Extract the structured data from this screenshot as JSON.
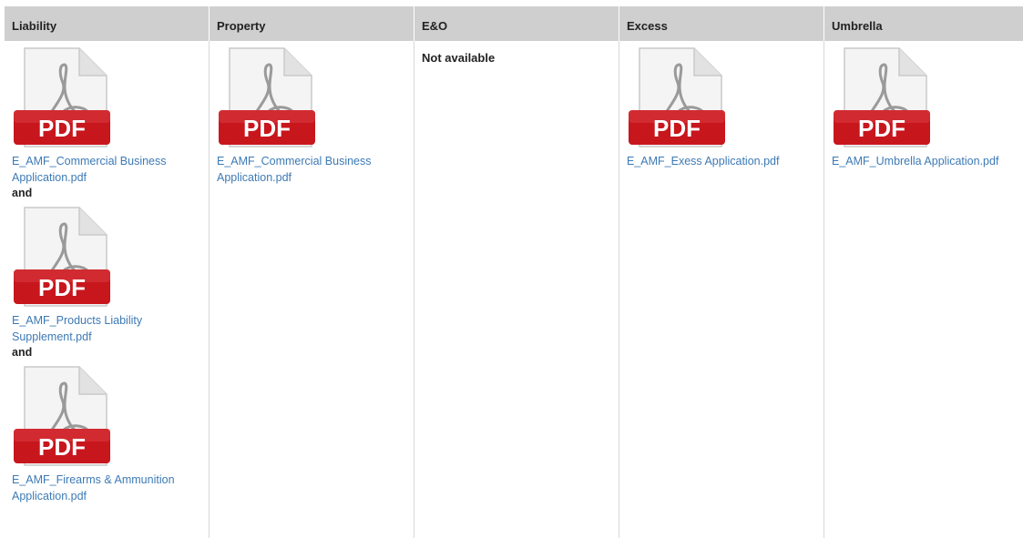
{
  "headers": [
    "Liability",
    "Property",
    "E&O",
    "Excess",
    "Umbrella"
  ],
  "icon": {
    "name": "pdf-icon",
    "label": "PDF",
    "band_color": "#c8161d",
    "symbol_color": "#8c8c8c"
  },
  "columns": {
    "liability": {
      "docs": [
        {
          "link": "E_AMF_Commercial Business Application.pdf"
        },
        {
          "link": "E_AMF_Products Liability Supplement.pdf"
        },
        {
          "link": "E_AMF_Firearms & Ammunition Application.pdf"
        }
      ],
      "separator": "and"
    },
    "property": {
      "docs": [
        {
          "link": "E_AMF_Commercial Business Application.pdf"
        }
      ]
    },
    "eo": {
      "status": "Not available"
    },
    "excess": {
      "docs": [
        {
          "link": "E_AMF_Exess Application.pdf"
        }
      ]
    },
    "umbrella": {
      "docs": [
        {
          "link": "E_AMF_Umbrella Application.pdf"
        }
      ]
    }
  }
}
